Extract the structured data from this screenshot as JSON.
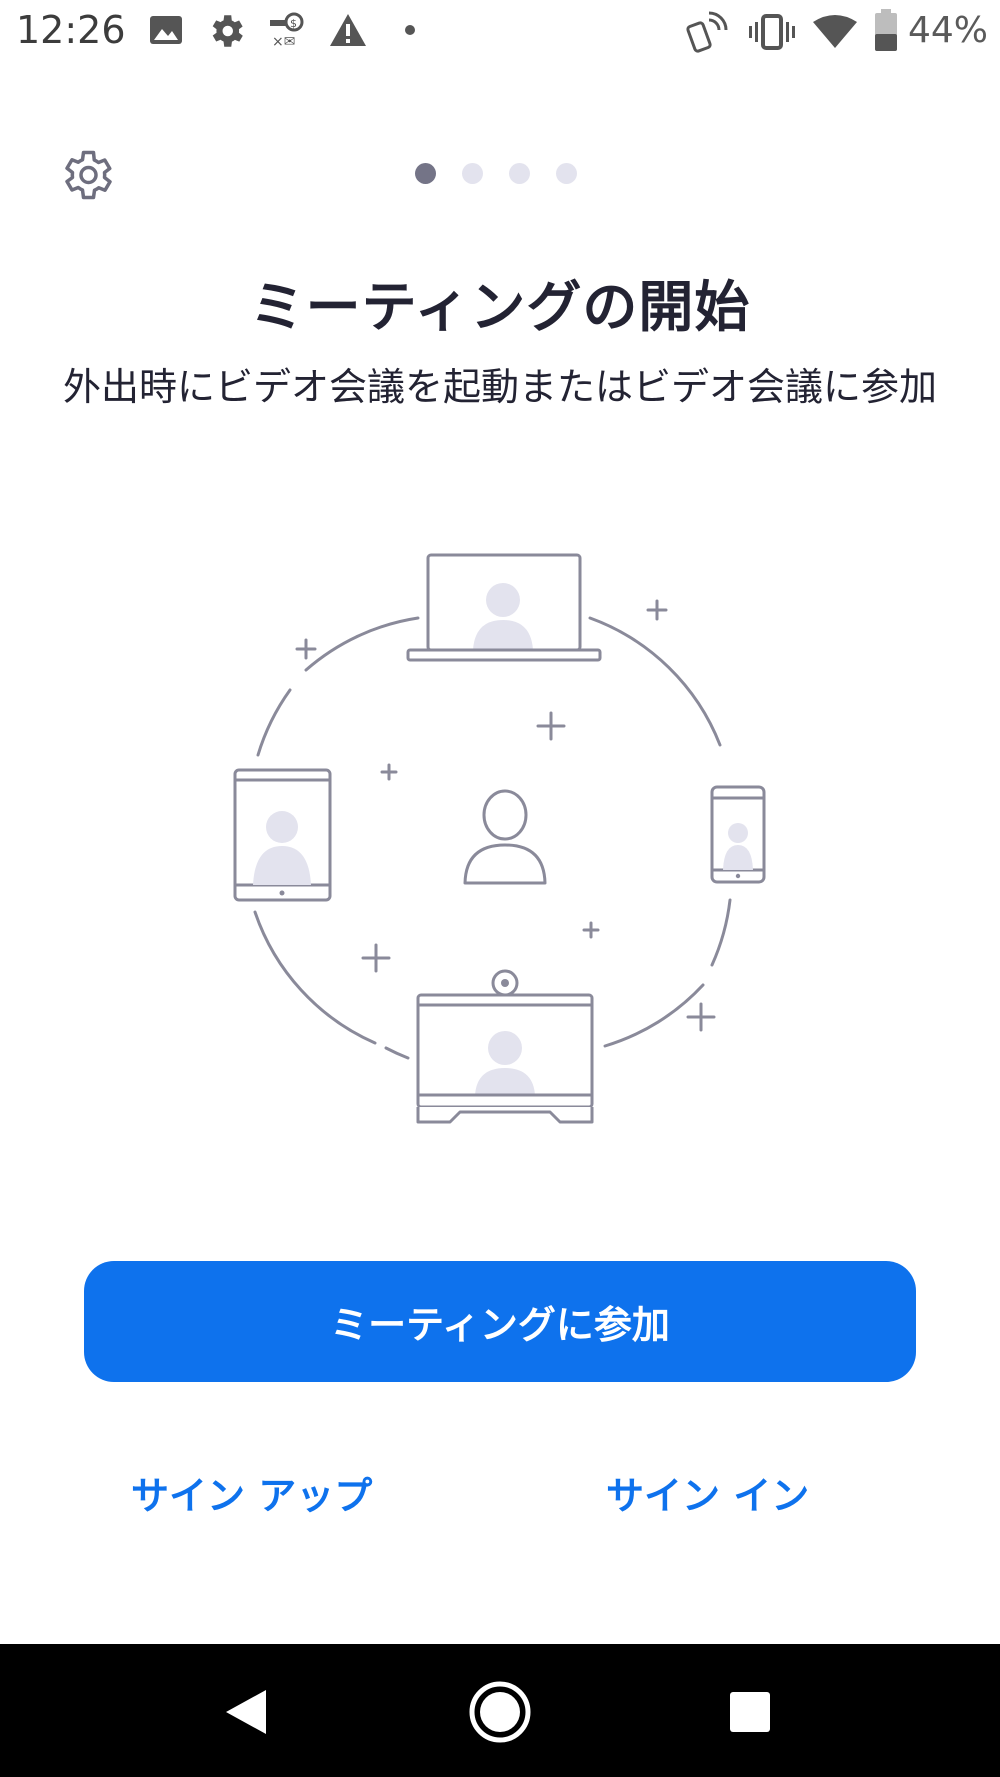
{
  "status_bar": {
    "time": "12:26",
    "battery_percent_text": "44%",
    "battery_level": 0.44,
    "icons": [
      "image-icon",
      "gear-icon",
      "key-icon",
      "warning-icon",
      "dot-icon",
      "nfc-icon",
      "vibrate-icon",
      "wifi-icon",
      "battery-icon"
    ]
  },
  "header": {
    "settings_icon": "gear-icon",
    "pager": {
      "count": 4,
      "active_index": 0
    }
  },
  "main": {
    "title": "ミーティングの開始",
    "subtitle": "外出時にビデオ会議を起動またはビデオ会議に参加"
  },
  "actions": {
    "join_label": "ミーティングに参加",
    "signup_label": "サイン アップ",
    "signin_label": "サイン イン"
  },
  "colors": {
    "accent": "#0e72ed",
    "illustration_stroke": "#8a8a9a",
    "illustration_fill": "#e3e3ee",
    "dot_active": "#747487",
    "dot_inactive": "#e3e3ee",
    "nav_bg": "#000000"
  },
  "nav_bar": {
    "icons": [
      "back-icon",
      "home-icon",
      "recents-icon"
    ]
  }
}
